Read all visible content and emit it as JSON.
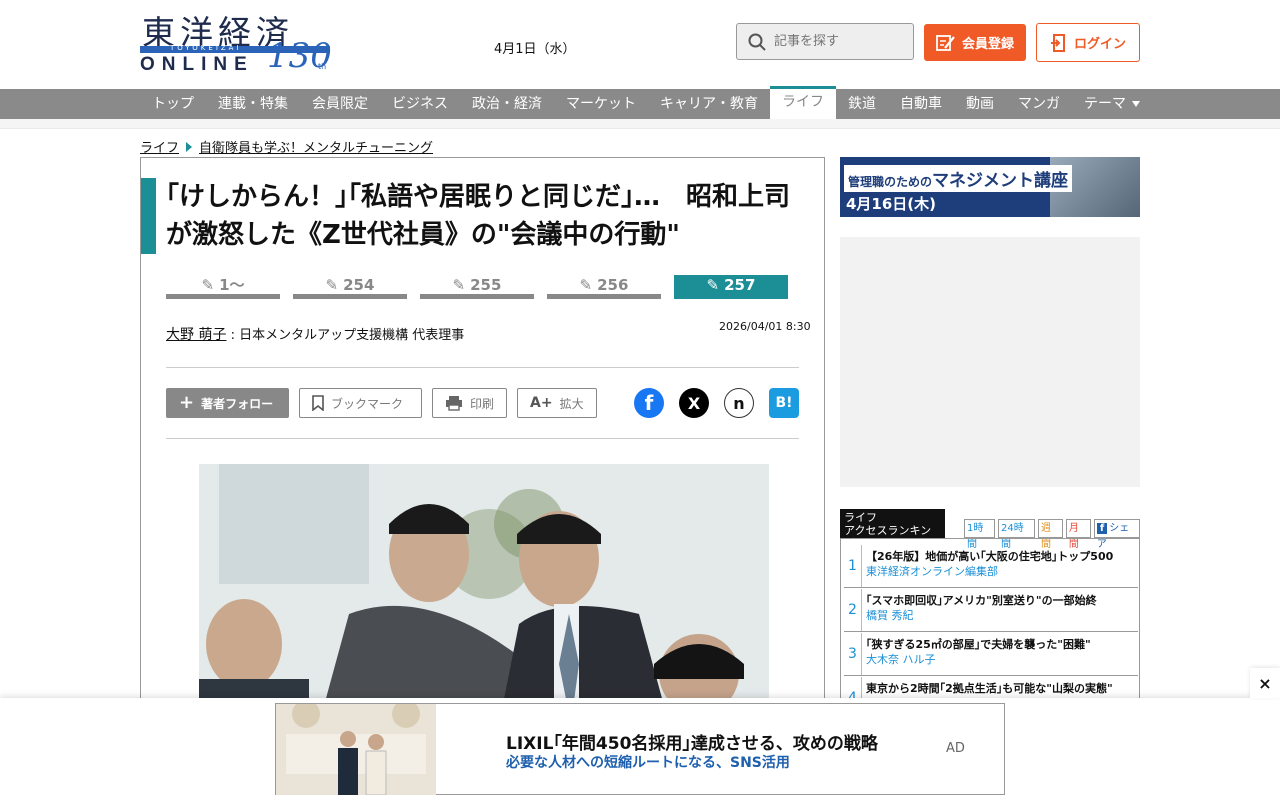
{
  "header": {
    "logo": {
      "kanji": "東洋経済",
      "band": "TOYOKEIZAI",
      "online": "ONLINE",
      "anniv": "130",
      "anniv_suffix": "th"
    },
    "date": "4月1日（水）",
    "search_placeholder": "記事を探す",
    "register_label": "会員登録",
    "login_label": "ログイン",
    "accent_color": "#ef5a26"
  },
  "nav": {
    "items": [
      "トップ",
      "連載・特集",
      "会員限定",
      "ビジネス",
      "政治・経済",
      "マーケット",
      "キャリア・教育",
      "ライフ",
      "鉄道",
      "自動車",
      "動画",
      "マンガ",
      "テーマ"
    ],
    "active": "ライフ"
  },
  "breadcrumb": [
    "ライフ",
    "自衛隊員も学ぶ！メンタルチューニング"
  ],
  "article": {
    "title": "｢けしからん！｣｢私語や居眠りと同じだ｣…　昭和上司が激怒した《Z世代社員》の\"会議中の行動\"",
    "pages": [
      "1〜",
      "254",
      "255",
      "256",
      "257"
    ],
    "current_page": "257",
    "author_name": "大野 萌子",
    "author_title": " : 日本メンタルアップ支援機構 代表理事",
    "published": "2026/04/01 8:30",
    "actions": {
      "follow": "著者フォロー",
      "bookmark": "ブックマーク",
      "print": "印刷",
      "zoom": "拡大"
    },
    "share": [
      "facebook-icon",
      "x-icon",
      "note-icon",
      "hatena-icon"
    ],
    "theme_color": "#1b8f95"
  },
  "sidebar": {
    "banner": {
      "title_small": "管理職のための",
      "title": "マネジメント講座",
      "date": "4月16日(木)"
    },
    "ranking": {
      "title_line1": "ライフ",
      "title_line2": "アクセスランキング",
      "tabs": [
        "1時間",
        "24時間",
        "週間",
        "月間",
        "シェア"
      ],
      "items": [
        {
          "rank": "1",
          "title": "【26年版】地価が高い｢大阪の住宅地｣トップ500",
          "author": "東洋経済オンライン編集部"
        },
        {
          "rank": "2",
          "title": "｢スマホ即回収｣アメリカ\"別室送り\"の一部始終",
          "author": "橋賀 秀紀"
        },
        {
          "rank": "3",
          "title": "｢狭すぎる25㎡の部屋｣で夫婦を襲った\"困難\"",
          "author": "大木奈 ハル子"
        },
        {
          "rank": "4",
          "title": "東京から2時間｢2拠点生活｣も可能な\"山梨の実態\"",
          "author": ""
        }
      ]
    }
  },
  "bottom_ad": {
    "title": "LIXIL｢年間450名採用｣達成させる、攻めの戦略",
    "subtitle": "必要な人材への短縮ルートになる、SNS活用",
    "label": "AD",
    "close": "×"
  }
}
